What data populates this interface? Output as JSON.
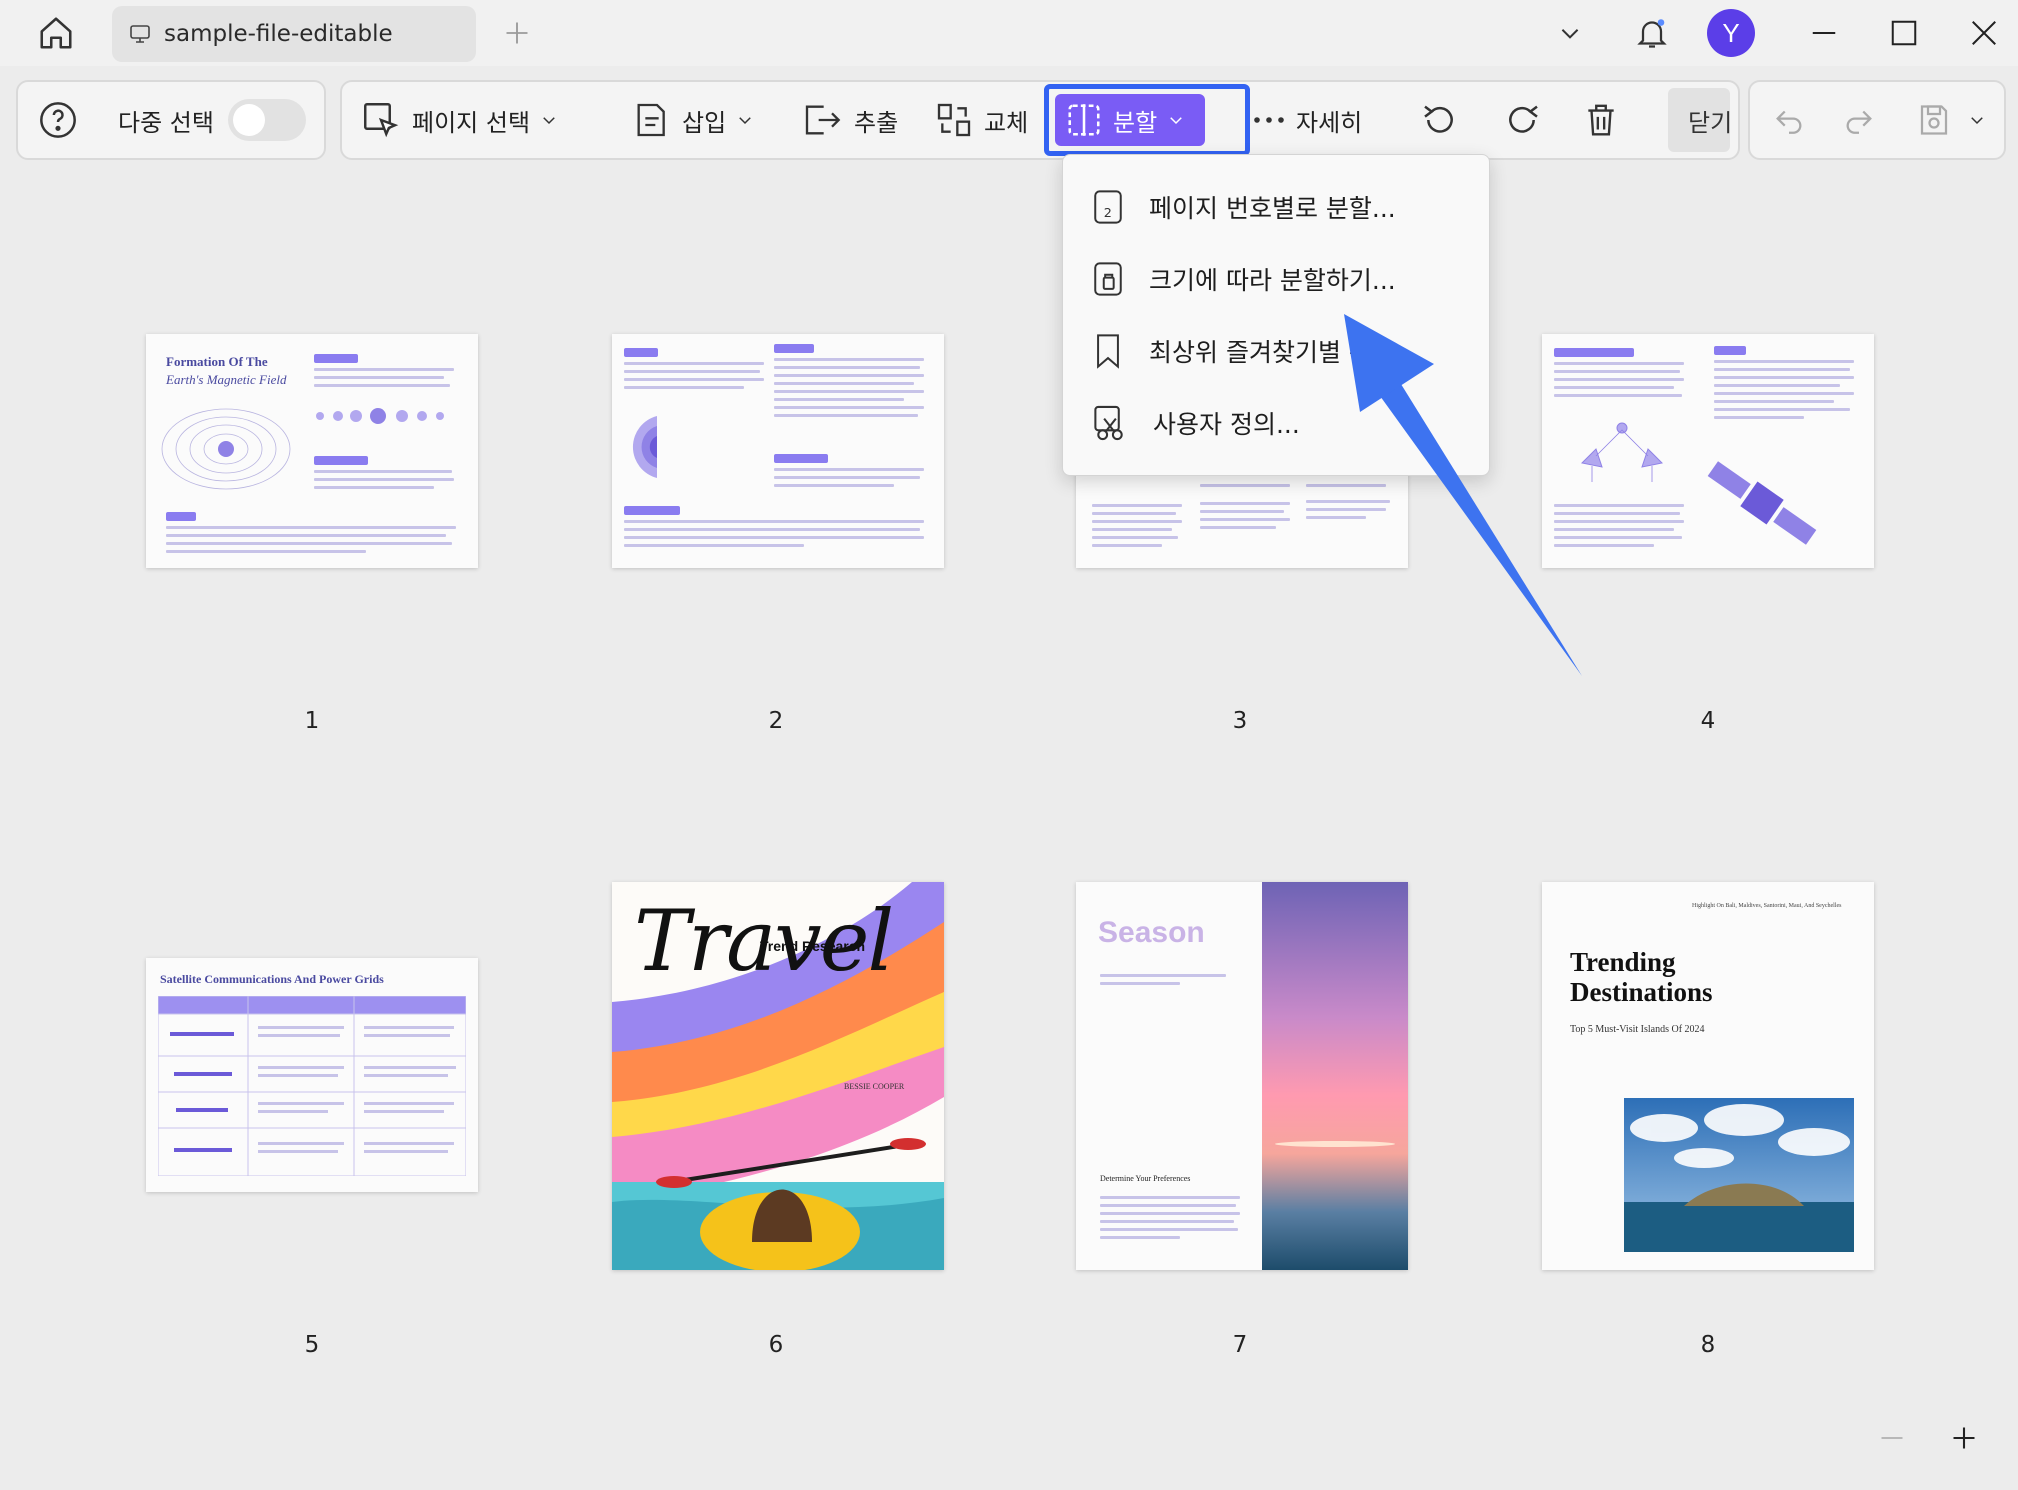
{
  "titlebar": {
    "tab_title": "sample-file-editable",
    "avatar_initial": "Y"
  },
  "toolbar": {
    "multi_select_label": "다중 선택",
    "page_select_label": "페이지 선택",
    "insert_label": "삽입",
    "extract_label": "추출",
    "replace_label": "교체",
    "split_label": "분할",
    "more_label": "자세히",
    "close_label": "닫기"
  },
  "split_menu": {
    "items": [
      {
        "label": "페이지 번호별로 분할..."
      },
      {
        "label": "크기에 따라 분할하기..."
      },
      {
        "label": "최상위 즐겨찾기별 분할..."
      },
      {
        "label": "사용자 정의..."
      }
    ]
  },
  "pages": [
    {
      "number": "1",
      "title_line1": "Formation Of The",
      "title_line2": "Earth's Magnetic Field"
    },
    {
      "number": "2"
    },
    {
      "number": "3"
    },
    {
      "number": "4"
    },
    {
      "number": "5",
      "title": "Satellite Communications And Power Grids"
    },
    {
      "number": "6",
      "headline": "Travel",
      "subtitle": "Trend Research",
      "author": "BESSIE COOPER"
    },
    {
      "number": "7",
      "headline": "Season",
      "section": "Determine Your Preferences"
    },
    {
      "number": "8",
      "headline_line1": "Trending",
      "headline_line2": "Destinations",
      "subtitle": "Top 5 Must-Visit Islands Of 2024",
      "top_note": "Highlight On Bali, Maldives, Santorini, Maui, And Seychelles"
    }
  ],
  "colors": {
    "accent": "#7a5cf5",
    "highlight_border": "#3262f2",
    "annotation_arrow": "#3d73f0",
    "avatar": "#5b3ee8"
  }
}
